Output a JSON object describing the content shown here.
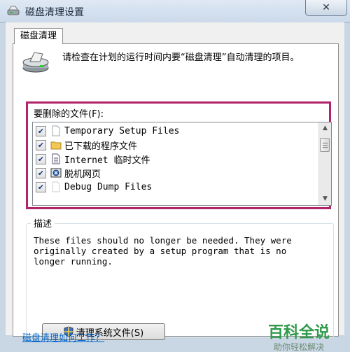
{
  "window": {
    "title": "磁盘清理设置",
    "close_glyph": "✕"
  },
  "tab": {
    "label": "磁盘清理"
  },
  "intro_text": "请检查在计划的运行时间内要“磁盘清理”自动清理的项目。",
  "files_label": "要删除的文件(F):",
  "files": [
    {
      "label": "Temporary Setup Files",
      "checked": true,
      "icon": "blank-file-icon"
    },
    {
      "label": "已下载的程序文件",
      "checked": true,
      "icon": "folder-icon"
    },
    {
      "label": "Internet 临时文件",
      "checked": true,
      "icon": "document-icon"
    },
    {
      "label": "脱机网页",
      "checked": true,
      "icon": "offline-webpage-icon"
    },
    {
      "label": "Debug Dump Files",
      "checked": true,
      "icon": "blank-file-icon"
    }
  ],
  "check_glyph": "✔",
  "description": {
    "legend": "描述",
    "text": "These files should no longer be needed. They were\noriginally created by a setup program that is no\nlonger running."
  },
  "cleanup_button": {
    "label": "清理系统文件(S)"
  },
  "watermark": {
    "main": "百科全说",
    "sub": "助你轻松解决"
  },
  "bottom_link": "磁盘清理如何工作？",
  "colors": {
    "highlight": "#b1246a",
    "accent_text": "#2f9a4a"
  }
}
